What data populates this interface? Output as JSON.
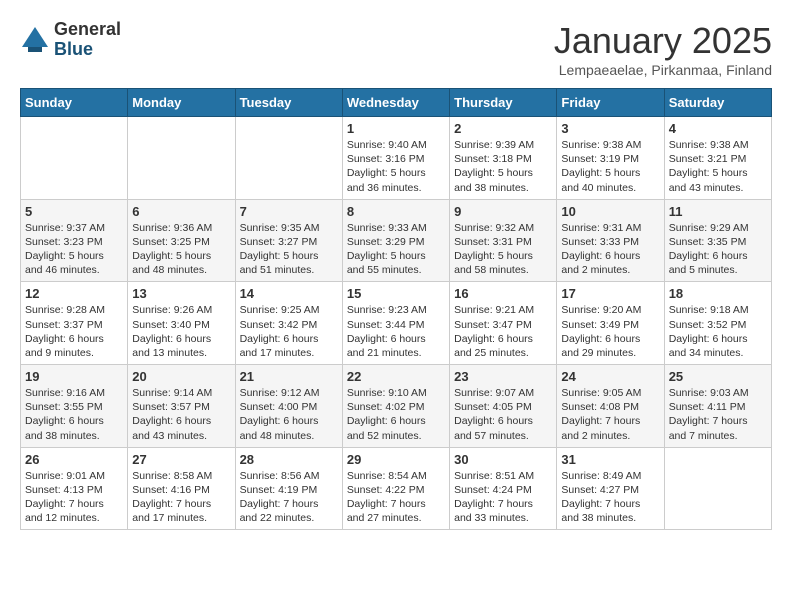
{
  "logo": {
    "general": "General",
    "blue": "Blue"
  },
  "header": {
    "month": "January 2025",
    "location": "Lempaeaelae, Pirkanmaa, Finland"
  },
  "weekdays": [
    "Sunday",
    "Monday",
    "Tuesday",
    "Wednesday",
    "Thursday",
    "Friday",
    "Saturday"
  ],
  "weeks": [
    [
      {
        "day": "",
        "info": ""
      },
      {
        "day": "",
        "info": ""
      },
      {
        "day": "",
        "info": ""
      },
      {
        "day": "1",
        "info": "Sunrise: 9:40 AM\nSunset: 3:16 PM\nDaylight: 5 hours and 36 minutes."
      },
      {
        "day": "2",
        "info": "Sunrise: 9:39 AM\nSunset: 3:18 PM\nDaylight: 5 hours and 38 minutes."
      },
      {
        "day": "3",
        "info": "Sunrise: 9:38 AM\nSunset: 3:19 PM\nDaylight: 5 hours and 40 minutes."
      },
      {
        "day": "4",
        "info": "Sunrise: 9:38 AM\nSunset: 3:21 PM\nDaylight: 5 hours and 43 minutes."
      }
    ],
    [
      {
        "day": "5",
        "info": "Sunrise: 9:37 AM\nSunset: 3:23 PM\nDaylight: 5 hours and 46 minutes."
      },
      {
        "day": "6",
        "info": "Sunrise: 9:36 AM\nSunset: 3:25 PM\nDaylight: 5 hours and 48 minutes."
      },
      {
        "day": "7",
        "info": "Sunrise: 9:35 AM\nSunset: 3:27 PM\nDaylight: 5 hours and 51 minutes."
      },
      {
        "day": "8",
        "info": "Sunrise: 9:33 AM\nSunset: 3:29 PM\nDaylight: 5 hours and 55 minutes."
      },
      {
        "day": "9",
        "info": "Sunrise: 9:32 AM\nSunset: 3:31 PM\nDaylight: 5 hours and 58 minutes."
      },
      {
        "day": "10",
        "info": "Sunrise: 9:31 AM\nSunset: 3:33 PM\nDaylight: 6 hours and 2 minutes."
      },
      {
        "day": "11",
        "info": "Sunrise: 9:29 AM\nSunset: 3:35 PM\nDaylight: 6 hours and 5 minutes."
      }
    ],
    [
      {
        "day": "12",
        "info": "Sunrise: 9:28 AM\nSunset: 3:37 PM\nDaylight: 6 hours and 9 minutes."
      },
      {
        "day": "13",
        "info": "Sunrise: 9:26 AM\nSunset: 3:40 PM\nDaylight: 6 hours and 13 minutes."
      },
      {
        "day": "14",
        "info": "Sunrise: 9:25 AM\nSunset: 3:42 PM\nDaylight: 6 hours and 17 minutes."
      },
      {
        "day": "15",
        "info": "Sunrise: 9:23 AM\nSunset: 3:44 PM\nDaylight: 6 hours and 21 minutes."
      },
      {
        "day": "16",
        "info": "Sunrise: 9:21 AM\nSunset: 3:47 PM\nDaylight: 6 hours and 25 minutes."
      },
      {
        "day": "17",
        "info": "Sunrise: 9:20 AM\nSunset: 3:49 PM\nDaylight: 6 hours and 29 minutes."
      },
      {
        "day": "18",
        "info": "Sunrise: 9:18 AM\nSunset: 3:52 PM\nDaylight: 6 hours and 34 minutes."
      }
    ],
    [
      {
        "day": "19",
        "info": "Sunrise: 9:16 AM\nSunset: 3:55 PM\nDaylight: 6 hours and 38 minutes."
      },
      {
        "day": "20",
        "info": "Sunrise: 9:14 AM\nSunset: 3:57 PM\nDaylight: 6 hours and 43 minutes."
      },
      {
        "day": "21",
        "info": "Sunrise: 9:12 AM\nSunset: 4:00 PM\nDaylight: 6 hours and 48 minutes."
      },
      {
        "day": "22",
        "info": "Sunrise: 9:10 AM\nSunset: 4:02 PM\nDaylight: 6 hours and 52 minutes."
      },
      {
        "day": "23",
        "info": "Sunrise: 9:07 AM\nSunset: 4:05 PM\nDaylight: 6 hours and 57 minutes."
      },
      {
        "day": "24",
        "info": "Sunrise: 9:05 AM\nSunset: 4:08 PM\nDaylight: 7 hours and 2 minutes."
      },
      {
        "day": "25",
        "info": "Sunrise: 9:03 AM\nSunset: 4:11 PM\nDaylight: 7 hours and 7 minutes."
      }
    ],
    [
      {
        "day": "26",
        "info": "Sunrise: 9:01 AM\nSunset: 4:13 PM\nDaylight: 7 hours and 12 minutes."
      },
      {
        "day": "27",
        "info": "Sunrise: 8:58 AM\nSunset: 4:16 PM\nDaylight: 7 hours and 17 minutes."
      },
      {
        "day": "28",
        "info": "Sunrise: 8:56 AM\nSunset: 4:19 PM\nDaylight: 7 hours and 22 minutes."
      },
      {
        "day": "29",
        "info": "Sunrise: 8:54 AM\nSunset: 4:22 PM\nDaylight: 7 hours and 27 minutes."
      },
      {
        "day": "30",
        "info": "Sunrise: 8:51 AM\nSunset: 4:24 PM\nDaylight: 7 hours and 33 minutes."
      },
      {
        "day": "31",
        "info": "Sunrise: 8:49 AM\nSunset: 4:27 PM\nDaylight: 7 hours and 38 minutes."
      },
      {
        "day": "",
        "info": ""
      }
    ]
  ]
}
